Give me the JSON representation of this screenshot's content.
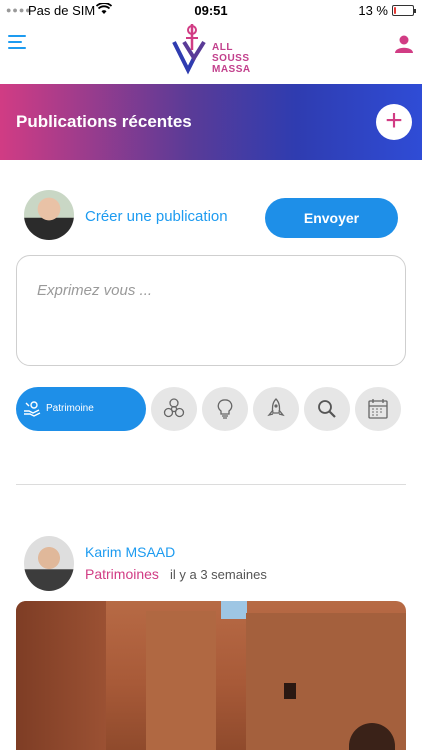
{
  "status_bar": {
    "carrier": "Pas de SIM",
    "time": "09:51",
    "battery_text": "13 %",
    "battery_level": 0.13
  },
  "header": {
    "logo_lines": [
      "ALL",
      "SOUSS",
      "MASSA"
    ]
  },
  "banner": {
    "title": "Publications récentes",
    "add_label": "+"
  },
  "composer": {
    "create_label": "Créer une publication",
    "send_label": "Envoyer",
    "placeholder": "Exprimez vous ..."
  },
  "categories": {
    "active_label": "Patrimoine",
    "icons": [
      "biohazard-icon",
      "lightbulb-icon",
      "rocket-icon",
      "search-icon",
      "calendar-icon"
    ]
  },
  "post": {
    "author": "Karim MSAAD",
    "category": "Patrimoines",
    "time": "il y a 3 semaines"
  },
  "colors": {
    "accent_blue": "#1e8fe8",
    "brand_pink": "#d13c84",
    "banner_purple": "#5a3b97"
  }
}
